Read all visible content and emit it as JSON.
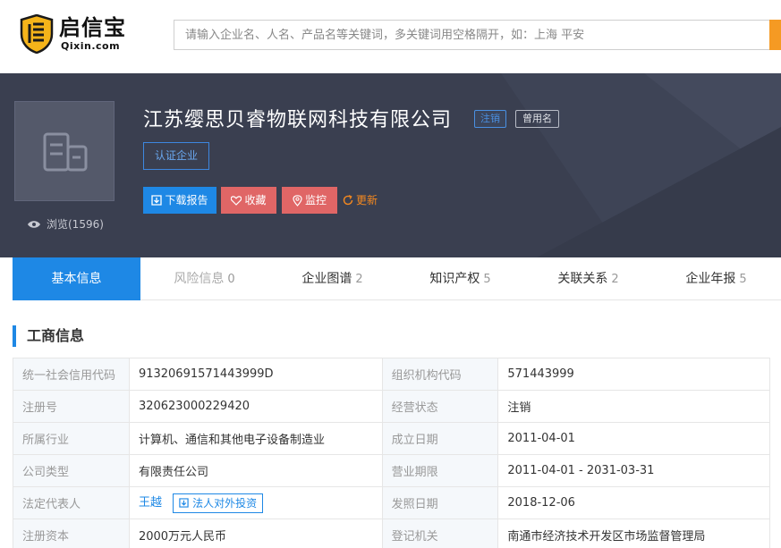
{
  "header": {
    "logo_text": "启信宝",
    "logo_sub": "Qixin.com",
    "search_placeholder": "请输入企业名、人名、产品名等关键词，多关键词用空格隔开，如：上海 平安"
  },
  "company": {
    "name": "江苏缨思贝睿物联网科技有限公司",
    "status_tag": "注销",
    "former_name_tag": "曾用名",
    "verify_label": "认证企业",
    "views_label": "浏览(1596)"
  },
  "actions": {
    "download": "下载报告",
    "collect": "收藏",
    "monitor": "监控",
    "refresh": "更新"
  },
  "tabs": [
    {
      "label": "基本信息",
      "count": ""
    },
    {
      "label": "风险信息",
      "count": "0"
    },
    {
      "label": "企业图谱",
      "count": "2"
    },
    {
      "label": "知识产权",
      "count": "5"
    },
    {
      "label": "关联关系",
      "count": "2"
    },
    {
      "label": "企业年报",
      "count": "5"
    }
  ],
  "section": {
    "title": "工商信息"
  },
  "info": {
    "credit_code_label": "统一社会信用代码",
    "credit_code": "91320691571443999D",
    "org_code_label": "组织机构代码",
    "org_code": "571443999",
    "reg_no_label": "注册号",
    "reg_no": "320623000229420",
    "status_label": "经营状态",
    "status": "注销",
    "industry_label": "所属行业",
    "industry": "计算机、通信和其他电子设备制造业",
    "founded_label": "成立日期",
    "founded": "2011-04-01",
    "type_label": "公司类型",
    "type": "有限责任公司",
    "term_label": "营业期限",
    "term": "2011-04-01 - 2031-03-31",
    "legal_rep_label": "法定代表人",
    "legal_rep": "王越",
    "legal_rep_invest": "法人对外投资",
    "license_date_label": "发照日期",
    "license_date": "2018-12-06",
    "capital_label": "注册资本",
    "capital": "2000万元人民币",
    "authority_label": "登记机关",
    "authority": "南通市经济技术开发区市场监督管理局"
  },
  "colors": {
    "brand_blue": "#1e88e5",
    "banner_bg": "#3a3f50",
    "danger": "#e06666",
    "accent_orange": "#f59a23"
  }
}
